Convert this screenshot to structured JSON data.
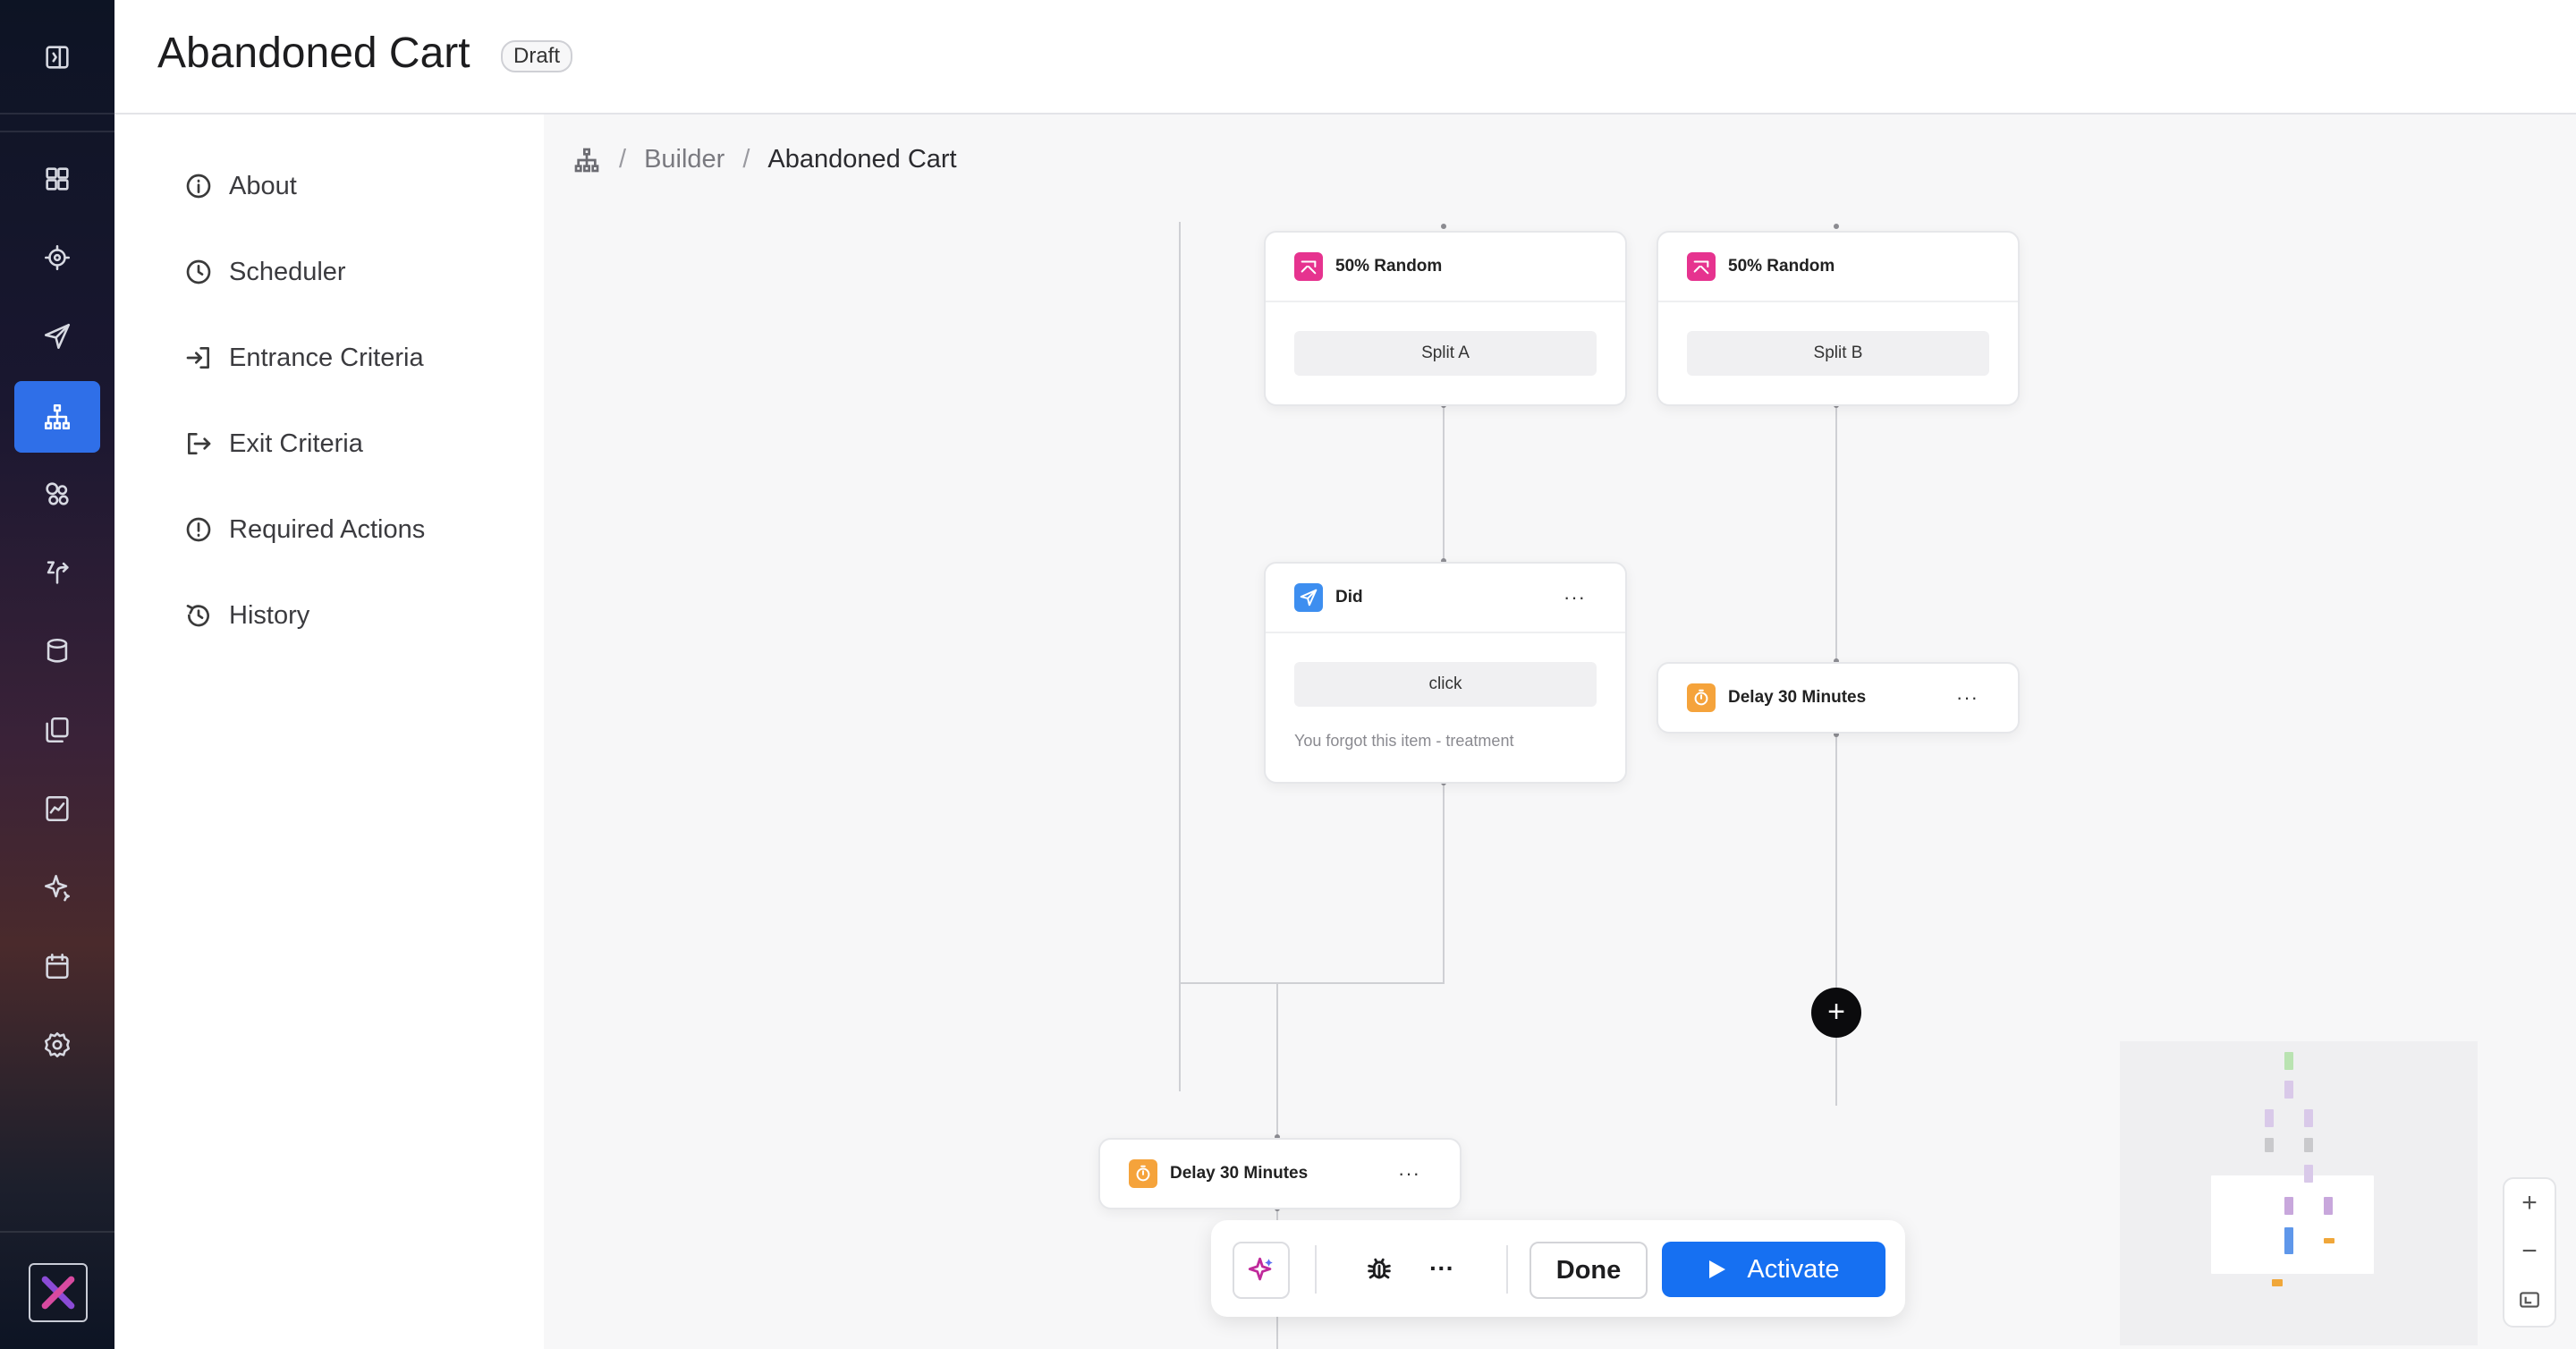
{
  "header": {
    "title": "Abandoned Cart",
    "status_badge": "Draft"
  },
  "sidebar_rail": {
    "items": [
      {
        "name": "toggle-panel-icon"
      },
      {
        "name": "dashboard-icon"
      },
      {
        "name": "target-icon"
      },
      {
        "name": "send-icon"
      },
      {
        "name": "journey-builder-icon",
        "active": true
      },
      {
        "name": "segments-icon"
      },
      {
        "name": "triggers-icon"
      },
      {
        "name": "database-icon"
      },
      {
        "name": "templates-icon"
      },
      {
        "name": "analytics-icon"
      },
      {
        "name": "ai-sparkle-icon"
      },
      {
        "name": "calendar-icon"
      },
      {
        "name": "settings-icon"
      }
    ],
    "active_color": "#2f6fe8"
  },
  "side_menu": {
    "items": [
      {
        "label": "About",
        "icon": "info-icon"
      },
      {
        "label": "Scheduler",
        "icon": "clock-icon"
      },
      {
        "label": "Entrance Criteria",
        "icon": "enter-icon"
      },
      {
        "label": "Exit Criteria",
        "icon": "exit-icon"
      },
      {
        "label": "Required Actions",
        "icon": "alert-icon"
      },
      {
        "label": "History",
        "icon": "history-icon"
      }
    ]
  },
  "breadcrumb": {
    "root_icon": "sitemap-icon",
    "parent": "Builder",
    "separator": "/",
    "current": "Abandoned Cart"
  },
  "nodes": {
    "split_a": {
      "title": "50% Random",
      "value": "Split A",
      "icon": "random-split-icon",
      "color": "#e6338f"
    },
    "split_b": {
      "title": "50% Random",
      "value": "Split B",
      "icon": "random-split-icon",
      "color": "#e6338f"
    },
    "did": {
      "title": "Did",
      "value": "click",
      "sub": "You forgot this item - treatment",
      "more": "···",
      "icon": "send-icon",
      "color": "#3d8ef0"
    },
    "delay_b": {
      "title": "Delay 30 Minutes",
      "more": "···",
      "icon": "timer-icon",
      "color": "#f5a33b"
    },
    "delay_main": {
      "title": "Delay 30 Minutes",
      "more": "···",
      "icon": "timer-icon",
      "color": "#f5a33b"
    }
  },
  "add_node_button": "+",
  "zoom_controls": {
    "zoom_in": "+",
    "zoom_out": "−",
    "fit_icon": "fit-view-icon"
  },
  "toolbar": {
    "ai_icon": "sparkle-icon",
    "debug_icon": "bug-icon",
    "more": "···",
    "done_label": "Done",
    "activate_label": "Activate",
    "activate_color": "#1670f2"
  }
}
